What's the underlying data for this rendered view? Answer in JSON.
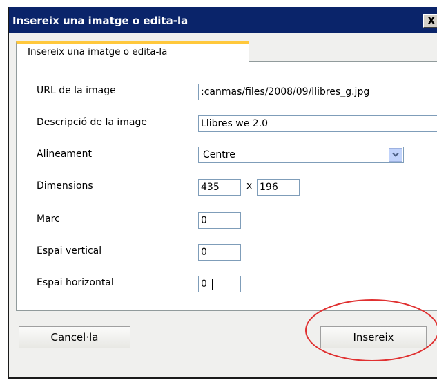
{
  "window": {
    "title": "Insereix una imatge o edita-la",
    "close_label": "X"
  },
  "tab": {
    "label": "Insereix una imatge o edita-la"
  },
  "form": {
    "url_label": "URL de la image",
    "url_value": ":canmas/files/2008/09/llibres_g.jpg",
    "description_label": "Descripció de la image",
    "description_value": "Llibres we 2.0",
    "alignment_label": "Alineament",
    "alignment_value": "Centre",
    "dimensions_label": "Dimensions",
    "width_value": "435",
    "times_symbol": "x",
    "height_value": "196",
    "border_label": "Marc",
    "border_value": "0",
    "vspace_label": "Espai vertical",
    "vspace_value": "0",
    "hspace_label": "Espai horizontal",
    "hspace_value": "0"
  },
  "buttons": {
    "cancel_label": "Cancel·la",
    "insert_label": "Insereix"
  },
  "colors": {
    "titlebar": "#0a246a",
    "tab_accent": "#ffc83c",
    "annotation_ring": "#e03030"
  },
  "icons": {
    "select_arrow": "chevron-down-icon",
    "close": "close-icon"
  }
}
